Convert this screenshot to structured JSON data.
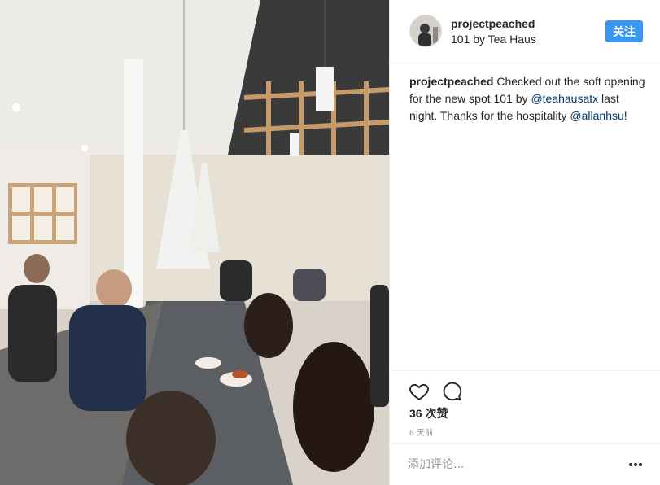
{
  "post": {
    "username": "projectpeached",
    "location": "101 by Tea Haus",
    "follow_label": "关注",
    "caption": {
      "user": "projectpeached",
      "text_1": " Checked out the soft opening for the new spot 101 by ",
      "mention_1": "@teahausatx",
      "text_2": " last night. Thanks for the hospitality ",
      "mention_2": "@allanhsu",
      "text_3": "!"
    },
    "likes": "36 次赞",
    "timestamp": "6 天前",
    "comment_placeholder": "添加评论...",
    "icons": {
      "like": "heart-outline-icon",
      "comment": "speech-bubble-icon",
      "more": "ellipsis-icon"
    }
  },
  "colors": {
    "accent": "#3897f0",
    "mention": "#003569",
    "muted": "#999999",
    "text": "#262626"
  }
}
